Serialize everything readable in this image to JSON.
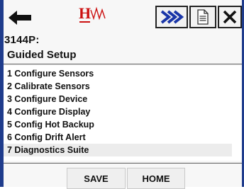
{
  "toolbar": {
    "back_icon": "left-arrow-icon",
    "logo_icon": "hart-logo-icon",
    "forward_icon": "double-chevron-right-icon",
    "doc_icon": "document-icon",
    "close_icon": "close-icon",
    "accent_color": "#1f3c8c",
    "forward_color": "#1a36a8",
    "logo_color": "#cc1111"
  },
  "device": {
    "title": "3144P:"
  },
  "section": {
    "title": "Guided Setup"
  },
  "menu": {
    "items": [
      {
        "label": "1 Configure Sensors"
      },
      {
        "label": "2 Calibrate Sensors"
      },
      {
        "label": "3 Configure Device"
      },
      {
        "label": "4 Configure Display"
      },
      {
        "label": "5 Config Hot Backup"
      },
      {
        "label": "6 Config Drift Alert"
      },
      {
        "label": "7 Diagnostics Suite"
      }
    ],
    "selected_index": 6
  },
  "buttons": {
    "save": "SAVE",
    "home": "HOME"
  }
}
